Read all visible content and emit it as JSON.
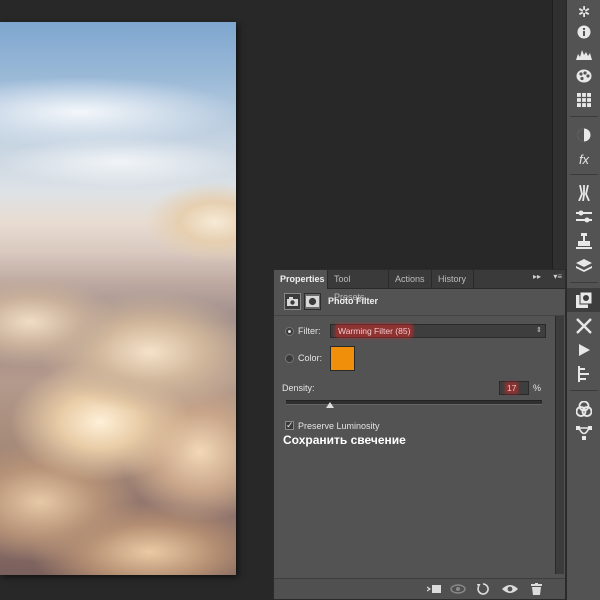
{
  "panel": {
    "tabs": [
      {
        "label": "Properties"
      },
      {
        "label": "Tool Presets"
      },
      {
        "label": "Actions"
      },
      {
        "label": "History"
      }
    ],
    "menu_glyph": "▸▸",
    "menu_lines": "▾≡",
    "title": "Photo Filter",
    "filter_label": "Filter:",
    "filter_value": "Warming Filter (85)",
    "color_label": "Color:",
    "color_value": "#f0900a",
    "density_label": "Density:",
    "density_value": "17",
    "density_unit": "%",
    "density_fraction": 0.17,
    "preserve_label": "Preserve Luminosity",
    "preserve_checked": true,
    "caption": "Сохранить свечение"
  },
  "dock": {
    "icons": [
      "gear-wheel-icon",
      "info-icon",
      "histogram-icon",
      "color-palette-icon",
      "swatches-grid-icon",
      "adjustments-icon",
      "styles-fx-icon",
      "brushes-icon",
      "brush-presets-icon",
      "clone-source-icon",
      "layers-icon",
      "properties-icon",
      "tools-icon",
      "play-icon",
      "timeline-icon",
      "channels-icon",
      "paths-icon"
    ]
  },
  "footer": {
    "icons": [
      "clip-to-layer-icon",
      "view-previous-state-icon",
      "reset-icon",
      "visibility-eye-icon",
      "delete-trash-icon"
    ]
  }
}
